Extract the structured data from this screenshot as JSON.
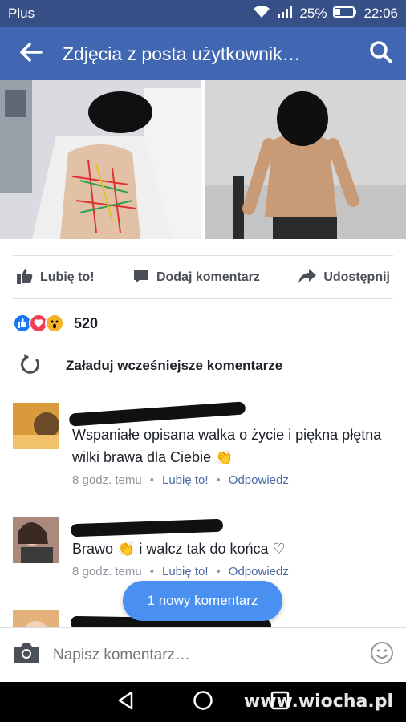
{
  "status_bar": {
    "carrier": "Plus",
    "battery": "25%",
    "time": "22:06"
  },
  "header": {
    "title": "Zdjęcia z posta użytkownik…",
    "back_icon": "arrow-left-icon",
    "search_icon": "search-icon"
  },
  "post_actions": [
    {
      "label": "Lubię to!",
      "icon": "thumbs-up-icon"
    },
    {
      "label": "Dodaj komentarz",
      "icon": "comment-icon"
    },
    {
      "label": "Udostępnij",
      "icon": "share-icon"
    }
  ],
  "reactions": {
    "icons": [
      "like",
      "love",
      "wow"
    ],
    "count": "520"
  },
  "load_earlier": {
    "label": "Załaduj wcześniejsze komentarze",
    "icon": "refresh-icon"
  },
  "comments": [
    {
      "text": "Wspaniałe opisana walka o życie i piękna płętna wilki brawa dla Ciebie 👏",
      "time": "8 godz. temu",
      "like": "Lubię to!",
      "reply": "Odpowiedz"
    },
    {
      "text": "Brawo 👏 i walcz tak do końca ♡",
      "time": "8 godz. temu",
      "like": "Lubię to!",
      "reply": "Odpowiedz"
    }
  ],
  "toast": {
    "label": "1 nowy komentarz"
  },
  "composer": {
    "placeholder": "Napisz komentarz…"
  },
  "watermark": "www.wiocha.pl",
  "colors": {
    "brand": "#4267b2",
    "status_bar": "#364f87",
    "toast": "#4a90f0",
    "link": "#4b6aa4"
  }
}
